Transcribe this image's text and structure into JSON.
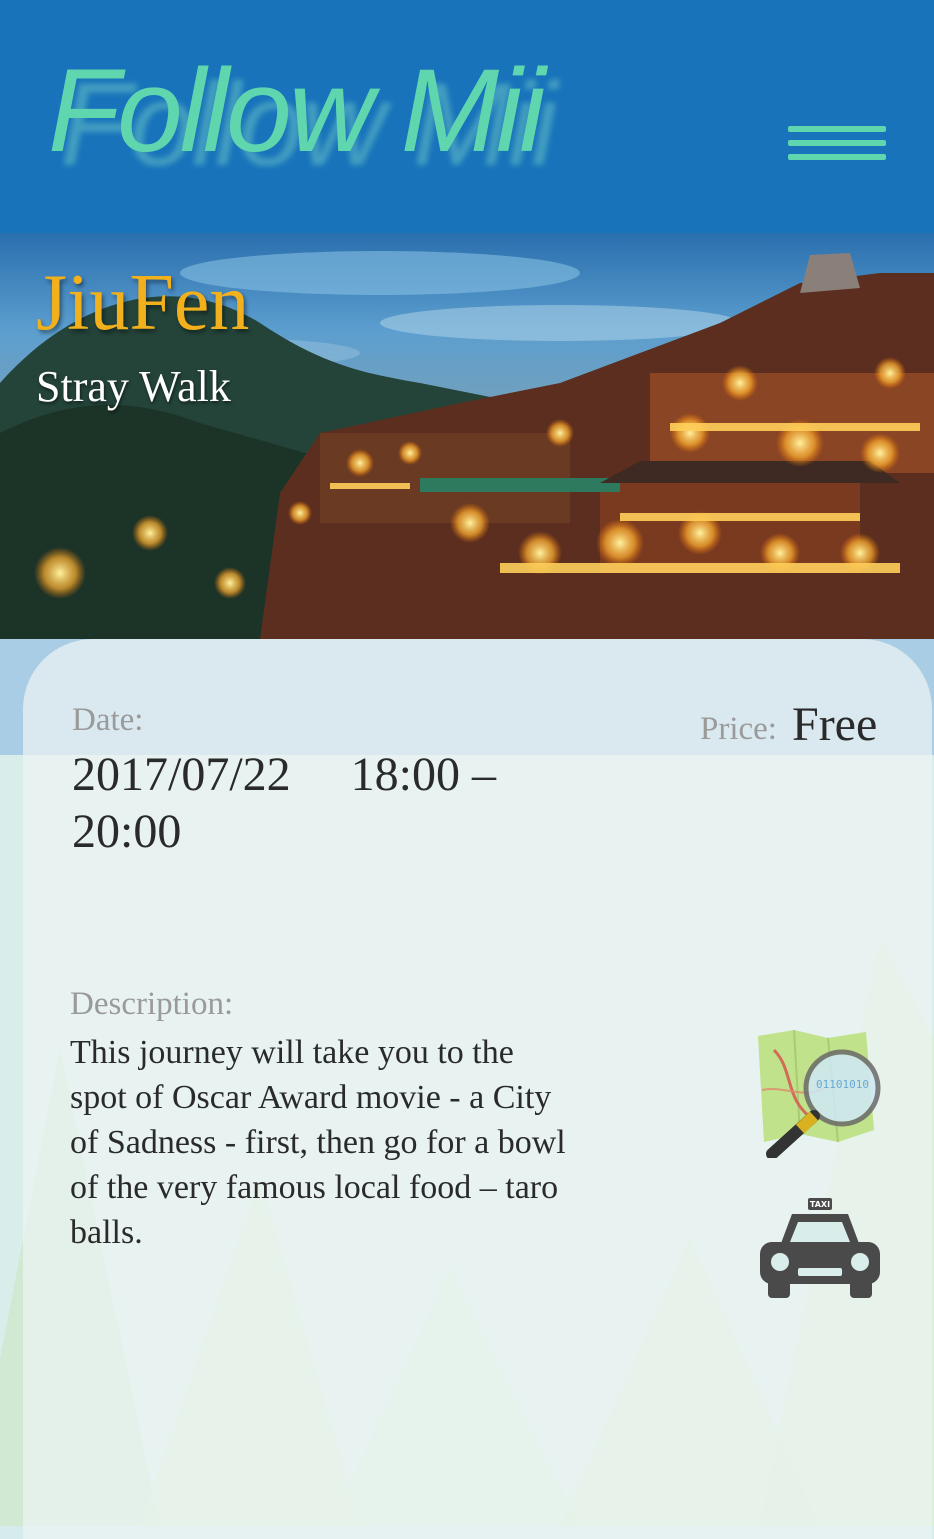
{
  "header": {
    "logo": "Follow Mii",
    "menu_icon": "hamburger-menu-icon",
    "accent_color": "#5fd6ae",
    "background_color": "#1873bb"
  },
  "hero": {
    "title": "JiuFen",
    "subtitle": "Stray Walk",
    "title_color": "#f2b01c"
  },
  "event": {
    "date_label": "Date:",
    "date_value": "2017/07/22     18:00 – 20:00",
    "price_label": "Price:",
    "price_value": "Free",
    "description_label": "Description:",
    "description_text": "This journey will take you to the spot of Oscar Award movie - a City of Sadness - first, then go for a bowl of the very famous local food – taro balls."
  },
  "actions": {
    "map_icon": "map-search-icon",
    "taxi_icon": "taxi-icon",
    "taxi_sign": "TAXI",
    "map_digits": "01101010"
  }
}
